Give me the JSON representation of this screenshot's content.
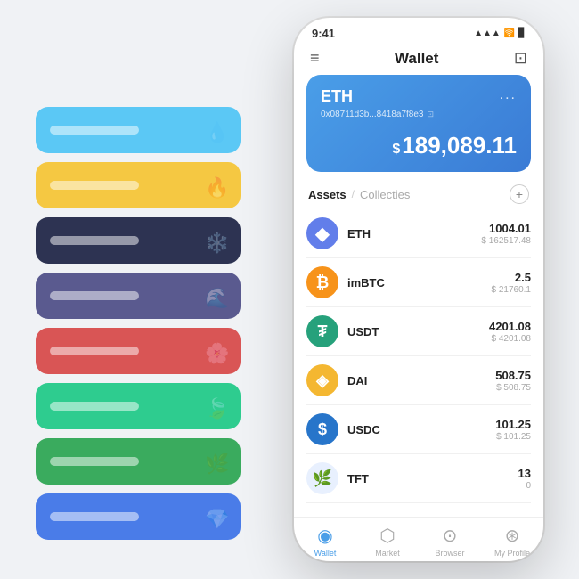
{
  "statusBar": {
    "time": "9:41",
    "signal": "●●●●",
    "wifi": "WiFi",
    "battery": "■■■"
  },
  "header": {
    "title": "Wallet",
    "menuIcon": "≡",
    "scanIcon": "⊡"
  },
  "ethCard": {
    "name": "ETH",
    "address": "0x08711d3b...8418a7f8e3",
    "copyIcon": "⊞",
    "moreIcon": "...",
    "balanceSymbol": "$",
    "balance": "189,089.11"
  },
  "assets": {
    "activeTab": "Assets",
    "divider": "/",
    "inactiveTab": "Collecties",
    "addIcon": "+"
  },
  "assetList": [
    {
      "symbol": "ETH",
      "iconType": "eth-icon",
      "iconText": "◆",
      "amount": "1004.01",
      "usdValue": "$ 162517.48"
    },
    {
      "symbol": "imBTC",
      "iconType": "imbtc-icon",
      "iconText": "₿",
      "amount": "2.5",
      "usdValue": "$ 21760.1"
    },
    {
      "symbol": "USDT",
      "iconType": "usdt-icon",
      "iconText": "₮",
      "amount": "4201.08",
      "usdValue": "$ 4201.08"
    },
    {
      "symbol": "DAI",
      "iconType": "dai-icon",
      "iconText": "◈",
      "amount": "508.75",
      "usdValue": "$ 508.75"
    },
    {
      "symbol": "USDC",
      "iconType": "usdc-icon",
      "iconText": "$",
      "amount": "101.25",
      "usdValue": "$ 101.25"
    },
    {
      "symbol": "TFT",
      "iconType": "tft-icon",
      "iconText": "🌿",
      "amount": "13",
      "usdValue": "0"
    }
  ],
  "bottomNav": [
    {
      "id": "wallet",
      "label": "Wallet",
      "icon": "👁",
      "active": true
    },
    {
      "id": "market",
      "label": "Market",
      "icon": "📈",
      "active": false
    },
    {
      "id": "browser",
      "label": "Browser",
      "icon": "👥",
      "active": false
    },
    {
      "id": "profile",
      "label": "My Profile",
      "icon": "👤",
      "active": false
    }
  ],
  "cardStack": [
    {
      "color": "#5bc8f5",
      "label": ""
    },
    {
      "color": "#f5c842",
      "label": ""
    },
    {
      "color": "#2d3352",
      "label": ""
    },
    {
      "color": "#5a5a8f",
      "label": ""
    },
    {
      "color": "#d95555",
      "label": ""
    },
    {
      "color": "#2ecc8f",
      "label": ""
    },
    {
      "color": "#3aab5e",
      "label": ""
    },
    {
      "color": "#4a7ce8",
      "label": ""
    }
  ]
}
